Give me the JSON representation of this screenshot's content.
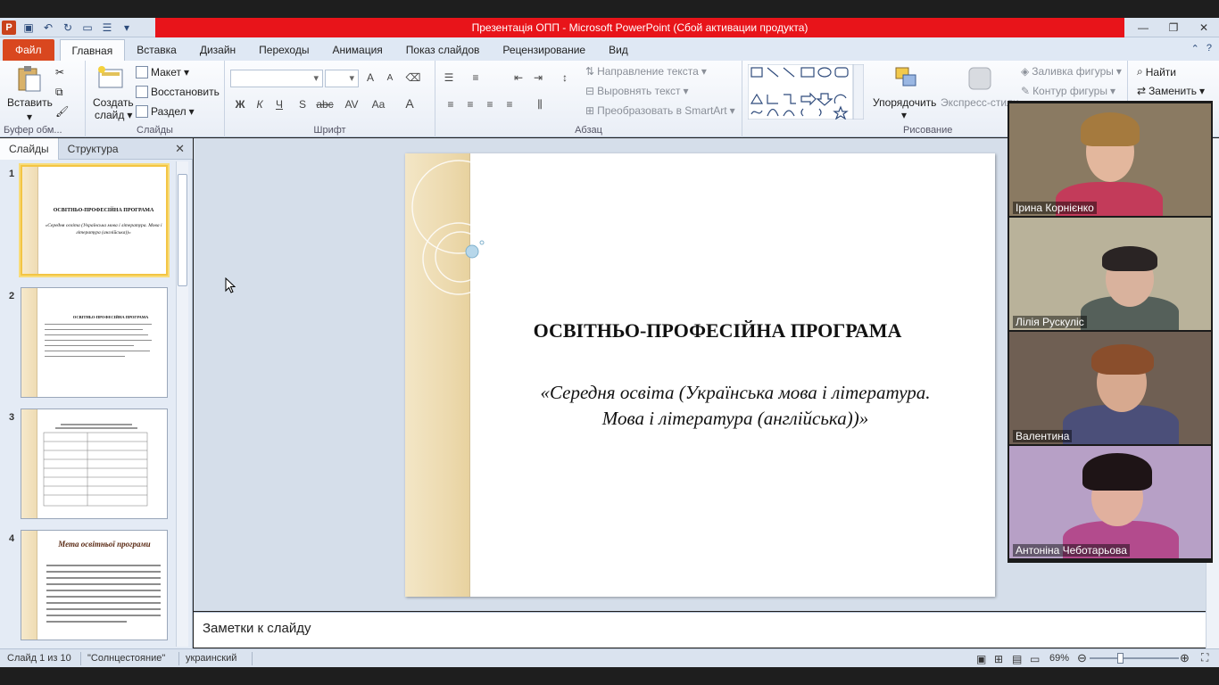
{
  "window": {
    "title": "Презентація ОПП  -  Microsoft PowerPoint (Сбой активации продукта)"
  },
  "tabs": [
    "Файл",
    "Главная",
    "Вставка",
    "Дизайн",
    "Переходы",
    "Анимация",
    "Показ слайдов",
    "Рецензирование",
    "Вид"
  ],
  "ribbon": {
    "clipboard": {
      "paste": "Вставить",
      "label": "Буфер обм..."
    },
    "slides": {
      "new_slide_line1": "Создать",
      "new_slide_line2": "слайд",
      "layout": "Макет",
      "reset": "Восстановить",
      "section": "Раздел",
      "label": "Слайды"
    },
    "font": {
      "label": "Шрифт",
      "bold": "Ж",
      "italic": "К",
      "underline": "Ч",
      "shadow": "S",
      "strike": "abc",
      "spacing": "AV",
      "case": "Aa",
      "color": "A",
      "grow": "A",
      "shrink": "A"
    },
    "paragraph": {
      "label": "Абзац",
      "text_direction": "Направление текста",
      "align_text": "Выровнять текст",
      "smartart": "Преобразовать в SmartArt"
    },
    "drawing": {
      "label": "Рисование",
      "arrange": "Упорядочить",
      "quick_styles": "Экспресс-стили",
      "fill": "Заливка фигуры",
      "outline": "Контур фигуры"
    },
    "editing": {
      "find": "Найти",
      "replace": "Заменить"
    }
  },
  "left_pane": {
    "tab_slides": "Слайды",
    "tab_outline": "Структура",
    "close": "✕",
    "thumbs": [
      {
        "num": "1",
        "title": "ОСВІТНЬО-ПРОФЕСІЙНА ПРОГРАМА",
        "sub": "«Середня освіта (Українська мова і література. Мова і література (англійська))»"
      },
      {
        "num": "2",
        "title": "ОСВІТНЬО-ПРОФЕСІЙНА ПРОГРАМА"
      },
      {
        "num": "3"
      },
      {
        "num": "4",
        "title": "Мета освітньої програми"
      }
    ]
  },
  "slide": {
    "title": "ОСВІТНЬО-ПРОФЕСІЙНА ПРОГРАМА",
    "subtitle_line1": "«Середня освіта (Українська мова і література.",
    "subtitle_line2": "Мова і література (англійська))»"
  },
  "notes": {
    "placeholder": "Заметки к слайду"
  },
  "status": {
    "slide_of": "Слайд 1 из 10",
    "theme": "\"Солнцестояние\"",
    "language": "украинский",
    "zoom": "69%"
  },
  "video": {
    "participants": [
      {
        "name": "Ірина Корнієнко",
        "bg": "#8a7a62",
        "shirt": "#c33b5a",
        "active": false
      },
      {
        "name": "Лілія Рускуліс",
        "bg": "#b9b29a",
        "shirt": "#55605a",
        "active": true
      },
      {
        "name": "Валентина",
        "bg": "#6f5f53",
        "shirt": "#4b4f79",
        "active": false
      },
      {
        "name": "Антоніна Чеботарьова",
        "bg": "#b7a0c6",
        "shirt": "#b34b8d",
        "active": false
      }
    ]
  },
  "colors": {
    "title_red": "#e8141a",
    "file_tab": "#d9471f",
    "accent_active": "#e7d54a"
  }
}
